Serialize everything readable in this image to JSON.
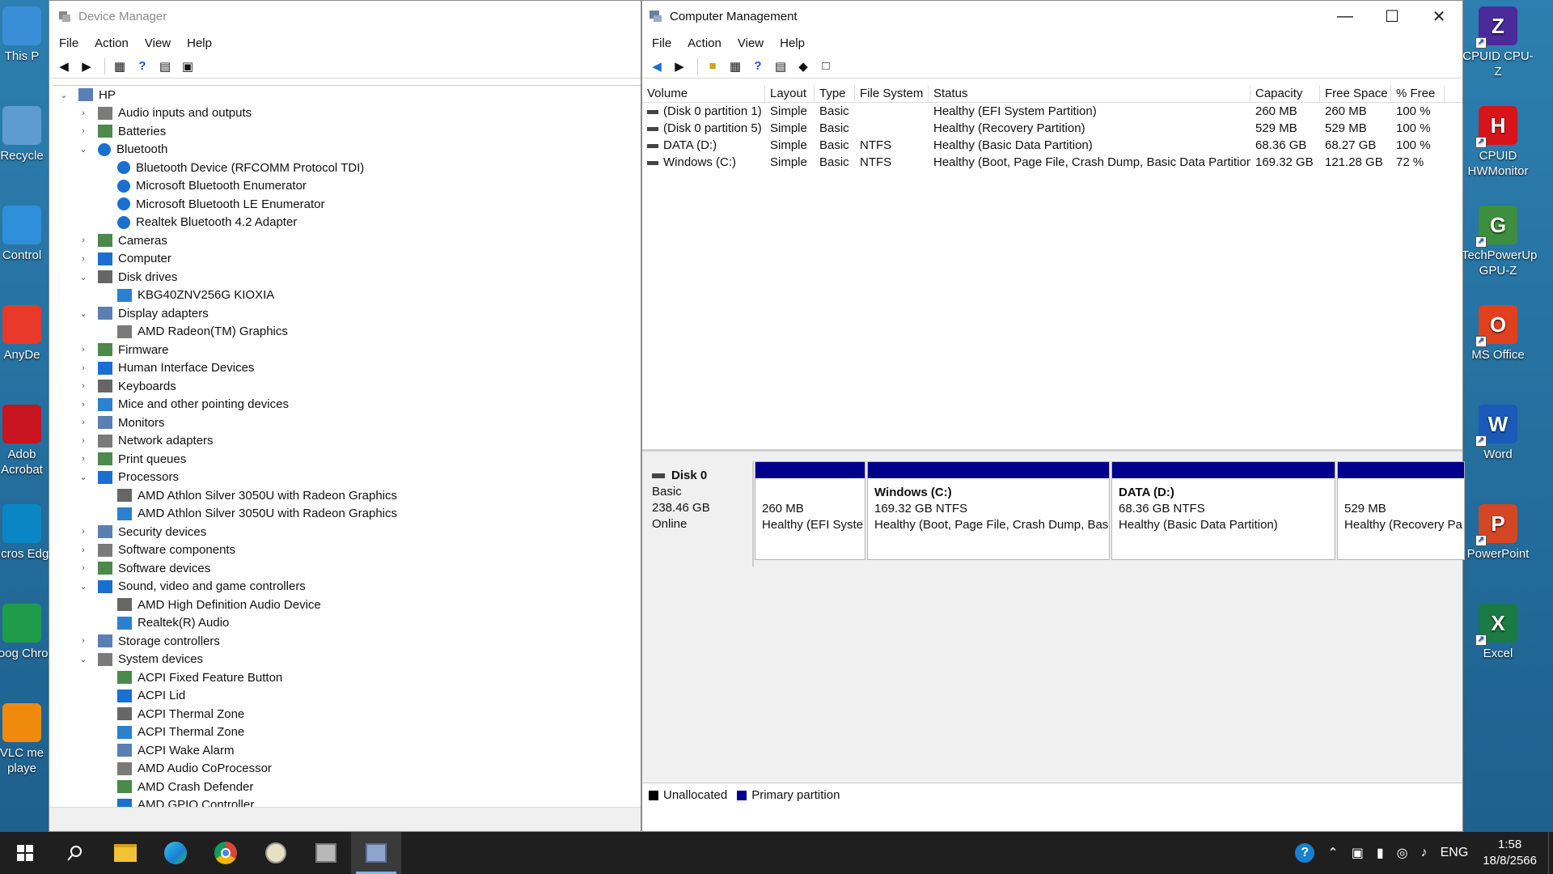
{
  "desktop_left": [
    {
      "label": "This P",
      "color": "#3a8ed8"
    },
    {
      "label": "Recycle",
      "color": "#5d9bd0"
    },
    {
      "label": "Control",
      "color": "#2f8fd8"
    },
    {
      "label": "AnyDe",
      "color": "#e8392b"
    },
    {
      "label": "Adob Acrobat",
      "color": "#c8141e"
    },
    {
      "label": "Micros Edge",
      "color": "#0b86c5"
    },
    {
      "label": "Goog Chron",
      "color": "#1f9c4a"
    },
    {
      "label": "VLC me playe",
      "color": "#f08a0c"
    }
  ],
  "desktop_right": [
    {
      "label": "CPUID CPU-Z",
      "glyph": "Z",
      "color": "#4b2a9a"
    },
    {
      "label": "CPUID HWMonitor",
      "glyph": "H",
      "color": "#d7141a"
    },
    {
      "label": "TechPowerUp GPU-Z",
      "glyph": "G",
      "color": "#3d8f3d"
    },
    {
      "label": "MS Office",
      "glyph": "O",
      "color": "#e1401f"
    },
    {
      "label": "Word",
      "glyph": "W",
      "color": "#1b5ab8"
    },
    {
      "label": "PowerPoint",
      "glyph": "P",
      "color": "#d24625"
    },
    {
      "label": "Excel",
      "glyph": "X",
      "color": "#1a7a43"
    }
  ],
  "device_manager": {
    "title": "Device Manager",
    "menu": [
      "File",
      "Action",
      "View",
      "Help"
    ],
    "tree": [
      {
        "level": 0,
        "exp": "v",
        "label": "HP"
      },
      {
        "level": 1,
        "exp": ">",
        "label": "Audio inputs and outputs"
      },
      {
        "level": 1,
        "exp": ">",
        "label": "Batteries"
      },
      {
        "level": 1,
        "exp": "v",
        "label": "Bluetooth"
      },
      {
        "level": 2,
        "exp": "",
        "label": "Bluetooth Device (RFCOMM Protocol TDI)"
      },
      {
        "level": 2,
        "exp": "",
        "label": "Microsoft Bluetooth Enumerator"
      },
      {
        "level": 2,
        "exp": "",
        "label": "Microsoft Bluetooth LE Enumerator"
      },
      {
        "level": 2,
        "exp": "",
        "label": "Realtek Bluetooth 4.2 Adapter"
      },
      {
        "level": 1,
        "exp": ">",
        "label": "Cameras"
      },
      {
        "level": 1,
        "exp": ">",
        "label": "Computer"
      },
      {
        "level": 1,
        "exp": "v",
        "label": "Disk drives"
      },
      {
        "level": 2,
        "exp": "",
        "label": "KBG40ZNV256G KIOXIA"
      },
      {
        "level": 1,
        "exp": "v",
        "label": "Display adapters"
      },
      {
        "level": 2,
        "exp": "",
        "label": "AMD Radeon(TM) Graphics"
      },
      {
        "level": 1,
        "exp": ">",
        "label": "Firmware"
      },
      {
        "level": 1,
        "exp": ">",
        "label": "Human Interface Devices"
      },
      {
        "level": 1,
        "exp": ">",
        "label": "Keyboards"
      },
      {
        "level": 1,
        "exp": ">",
        "label": "Mice and other pointing devices"
      },
      {
        "level": 1,
        "exp": ">",
        "label": "Monitors"
      },
      {
        "level": 1,
        "exp": ">",
        "label": "Network adapters"
      },
      {
        "level": 1,
        "exp": ">",
        "label": "Print queues"
      },
      {
        "level": 1,
        "exp": "v",
        "label": "Processors"
      },
      {
        "level": 2,
        "exp": "",
        "label": "AMD Athlon Silver 3050U with Radeon Graphics"
      },
      {
        "level": 2,
        "exp": "",
        "label": "AMD Athlon Silver 3050U with Radeon Graphics"
      },
      {
        "level": 1,
        "exp": ">",
        "label": "Security devices"
      },
      {
        "level": 1,
        "exp": ">",
        "label": "Software components"
      },
      {
        "level": 1,
        "exp": ">",
        "label": "Software devices"
      },
      {
        "level": 1,
        "exp": "v",
        "label": "Sound, video and game controllers"
      },
      {
        "level": 2,
        "exp": "",
        "label": "AMD High Definition Audio Device"
      },
      {
        "level": 2,
        "exp": "",
        "label": "Realtek(R) Audio"
      },
      {
        "level": 1,
        "exp": ">",
        "label": "Storage controllers"
      },
      {
        "level": 1,
        "exp": "v",
        "label": "System devices"
      },
      {
        "level": 2,
        "exp": "",
        "label": "ACPI Fixed Feature Button"
      },
      {
        "level": 2,
        "exp": "",
        "label": "ACPI Lid"
      },
      {
        "level": 2,
        "exp": "",
        "label": "ACPI Thermal Zone"
      },
      {
        "level": 2,
        "exp": "",
        "label": "ACPI Thermal Zone"
      },
      {
        "level": 2,
        "exp": "",
        "label": "ACPI Wake Alarm"
      },
      {
        "level": 2,
        "exp": "",
        "label": "AMD Audio CoProcessor"
      },
      {
        "level": 2,
        "exp": "",
        "label": "AMD Crash Defender"
      },
      {
        "level": 2,
        "exp": "",
        "label": "AMD GPIO Controller"
      }
    ]
  },
  "computer_management": {
    "title": "Computer Management",
    "menu": [
      "File",
      "Action",
      "View",
      "Help"
    ],
    "columns": [
      "Volume",
      "Layout",
      "Type",
      "File System",
      "Status",
      "Capacity",
      "Free Space",
      "% Free"
    ],
    "volumes": [
      [
        "(Disk 0 partition 1)",
        "Simple",
        "Basic",
        "",
        "Healthy (EFI System Partition)",
        "260 MB",
        "260 MB",
        "100 %"
      ],
      [
        "(Disk 0 partition 5)",
        "Simple",
        "Basic",
        "",
        "Healthy (Recovery Partition)",
        "529 MB",
        "529 MB",
        "100 %"
      ],
      [
        "DATA (D:)",
        "Simple",
        "Basic",
        "NTFS",
        "Healthy (Basic Data Partition)",
        "68.36 GB",
        "68.27 GB",
        "100 %"
      ],
      [
        "Windows (C:)",
        "Simple",
        "Basic",
        "NTFS",
        "Healthy (Boot, Page File, Crash Dump, Basic Data Partition)",
        "169.32 GB",
        "121.28 GB",
        "72 %"
      ]
    ],
    "disk": {
      "name": "Disk 0",
      "type": "Basic",
      "size": "238.46 GB",
      "state": "Online"
    },
    "partitions": [
      {
        "name": "",
        "size": "260 MB",
        "status": "Healthy (EFI Syste"
      },
      {
        "name": "Windows  (C:)",
        "size": "169.32 GB NTFS",
        "status": "Healthy (Boot, Page File, Crash Dump, Bas"
      },
      {
        "name": "DATA  (D:)",
        "size": "68.36 GB NTFS",
        "status": "Healthy (Basic Data Partition)"
      },
      {
        "name": "",
        "size": "529 MB",
        "status": "Healthy (Recovery Pa"
      }
    ],
    "legend": [
      {
        "label": "Unallocated",
        "color": "#000000"
      },
      {
        "label": "Primary partition",
        "color": "#00008b"
      }
    ]
  },
  "taskbar": {
    "lang": "ENG",
    "time": "1:58",
    "date": "18/8/2566"
  }
}
